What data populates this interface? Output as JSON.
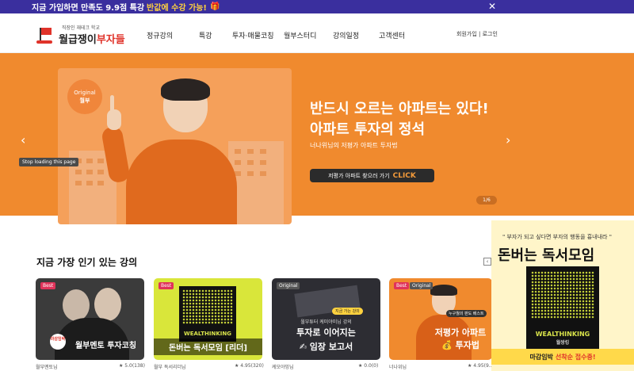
{
  "promo_bar": {
    "text": "지금 가입하면 만족도 9.9점 특강",
    "highlight": "반값에 수강 가능!",
    "gift": "🎁",
    "close": "✕"
  },
  "header": {
    "logo_small": "직장인 재테크 학교",
    "logo_main_a": "월급쟁이",
    "logo_main_b": "부자들",
    "nav": [
      "정규강의",
      "특강",
      "투자·매물코칭",
      "월부스터디",
      "강의일정",
      "고객센터"
    ],
    "auth": "회원가입 | 로그인"
  },
  "hero": {
    "badge_en": "Original",
    "badge_ko": "월부",
    "title_line1": "반드시 오르는 아파트는 있다!",
    "title_line2": "아파트 투자의 정석",
    "subtitle": "너나위님의 저평가 아파트 투자법",
    "cta_label": "저평가 아파트 찾으러 가기",
    "cta_click": "CLICK",
    "prev": "‹",
    "next": "›",
    "stop_loading": "Stop loading this page",
    "pager": "1/6"
  },
  "popular": {
    "title": "지금 가장 인기 있는 강의",
    "prev": "‹",
    "courses": [
      {
        "tag": "Best",
        "title": "월부멘토 투자코칭",
        "circle": "마감임박",
        "author": "월부멘토님",
        "rating": "★ 5.0(138)"
      },
      {
        "tag": "Best",
        "title": "돈버는 독서모임 [리더]",
        "book": "WEALTHINKING",
        "author": "월부 독서리더님",
        "rating": "★ 4.95(320)"
      },
      {
        "tag": "Original",
        "title": "투자로 이어지는",
        "title2": "✍ 임장 보고서",
        "pill": "지금 가는 강의",
        "top": "월부튜터 케미야미님 강의",
        "author": "케모야밍님",
        "rating": "★ 0.0(0)"
      },
      {
        "tag": "Best",
        "tag2": "Original",
        "title": "저평가 아파트",
        "title2": "💰 투자법",
        "pill": "누구월의 판도 배스트",
        "author": "너나위님",
        "rating": "★ 4.95(9..."
      }
    ]
  },
  "side_ad": {
    "quote": "\" 부자가 되고 싶다면 부자의 행동을 흉내내라 \"",
    "title": "돈버는 독서모임",
    "book_label": "WEALTHINKING",
    "book_sub": "월쌍킹",
    "band_a": "마감임박",
    "band_b": "선착순 접수중!"
  },
  "colors": {
    "promo_bg": "#3a2f9e",
    "hero_bg": "#f08a2e",
    "brand_red": "#e0332a",
    "highlight_yellow": "#ffd23f"
  }
}
